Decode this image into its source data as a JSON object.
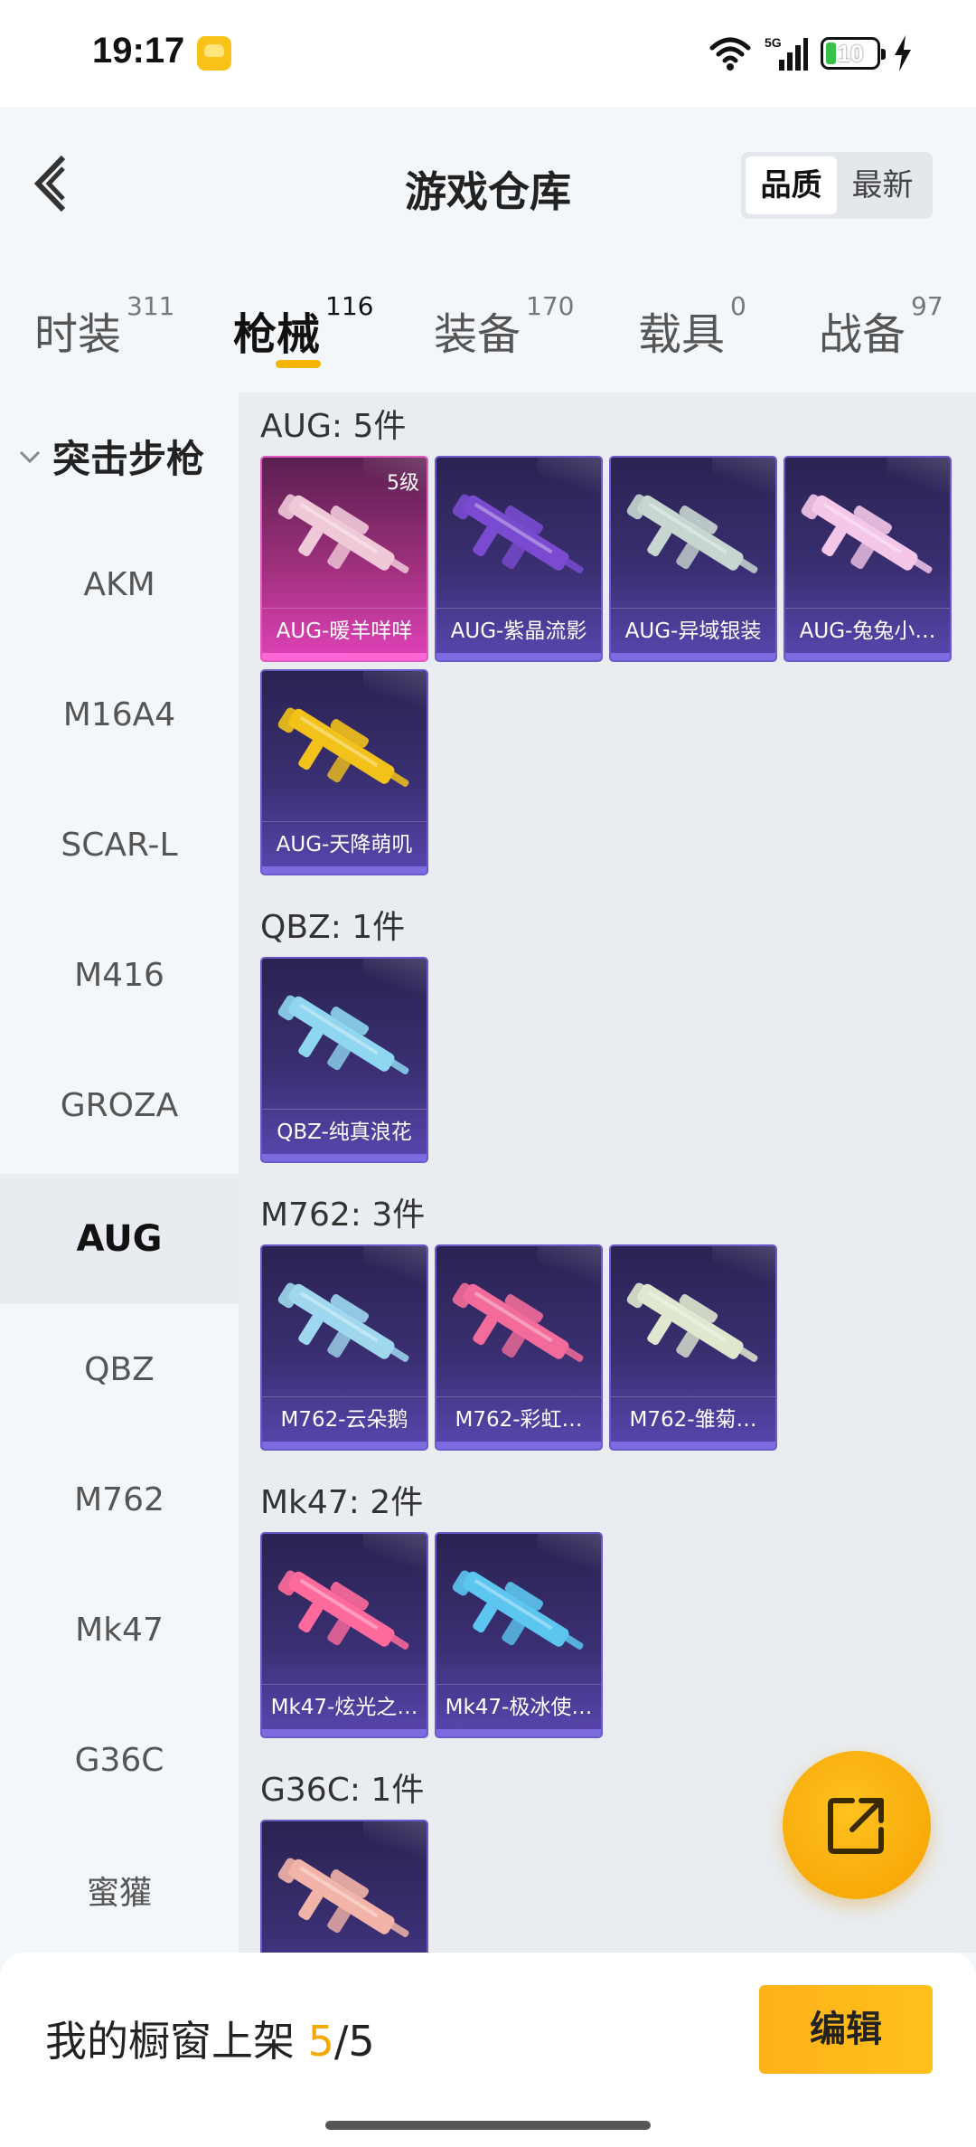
{
  "status": {
    "time": "19:17",
    "network": "5G",
    "battery": "10"
  },
  "header": {
    "title": "游戏仓库",
    "sort_options": [
      "品质",
      "最新"
    ],
    "sort_active": "品质"
  },
  "tabs": [
    {
      "label": "时装",
      "count": "311"
    },
    {
      "label": "枪械",
      "count": "116",
      "active": true
    },
    {
      "label": "装备",
      "count": "170"
    },
    {
      "label": "载具",
      "count": "0"
    },
    {
      "label": "战备",
      "count": "97"
    }
  ],
  "sidebar": {
    "group": "突击步枪",
    "items": [
      "AKM",
      "M16A4",
      "SCAR-L",
      "M416",
      "GROZA",
      "AUG",
      "QBZ",
      "M762",
      "Mk47",
      "G36C",
      "蜜獾"
    ],
    "active": "AUG"
  },
  "sections": [
    {
      "title": "AUG: 5件",
      "items": [
        {
          "label": "AUG-暖羊咩咩",
          "level": "5级",
          "rarity": "gold",
          "color": "#f0c9d8"
        },
        {
          "label": "AUG-紫晶流影",
          "rarity": "purple",
          "color": "#7a4bd0"
        },
        {
          "label": "AUG-异域银装",
          "rarity": "purple",
          "color": "#c8d6d0"
        },
        {
          "label": "AUG-兔兔小…",
          "rarity": "purple",
          "color": "#f4c6e8"
        },
        {
          "label": "AUG-天降萌叽",
          "rarity": "purple",
          "color": "#f2c21a"
        }
      ]
    },
    {
      "title": "QBZ: 1件",
      "items": [
        {
          "label": "QBZ-纯真浪花",
          "rarity": "purple",
          "color": "#8fd6f0"
        }
      ]
    },
    {
      "title": "M762: 3件",
      "items": [
        {
          "label": "M762-云朵鹅",
          "rarity": "purple",
          "color": "#9fd8ee"
        },
        {
          "label": "M762-彩虹…",
          "rarity": "purple",
          "color": "#f26b9a"
        },
        {
          "label": "M762-雏菊…",
          "rarity": "purple",
          "color": "#dfe8cf"
        }
      ]
    },
    {
      "title": "Mk47: 2件",
      "items": [
        {
          "label": "Mk47-炫光之…",
          "rarity": "purple",
          "color": "#ff6a9c"
        },
        {
          "label": "Mk47-极冰使…",
          "rarity": "purple",
          "color": "#5cc6f0"
        }
      ]
    },
    {
      "title": "G36C: 1件",
      "items": [
        {
          "label": "",
          "rarity": "purple",
          "color": "#f2b4a8"
        }
      ]
    }
  ],
  "bottom": {
    "showcase_label": "我的橱窗上架",
    "showcase_current": "5",
    "showcase_total": "5",
    "edit_label": "编辑"
  },
  "colors": {
    "accent": "#f5b400",
    "card_purple": "#5a46b0",
    "card_gold": "#e042b8"
  }
}
